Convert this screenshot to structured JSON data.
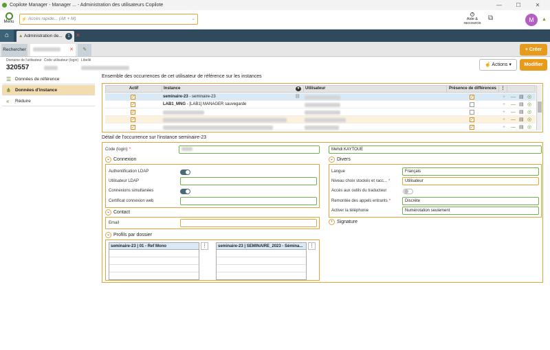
{
  "window": {
    "title": "Copilote Manager - Manager ... - Administration des utilisateurs Copilote"
  },
  "topbar": {
    "menu_label": "Menu",
    "quick_placeholder": "Accès rapide... (Alt + M)",
    "help_label": "Aide & raccourcis",
    "avatar_initial": "M"
  },
  "tabs": {
    "admin_label": "Administration de...",
    "admin_badge": "1"
  },
  "subtabs": {
    "search_label": "Rechercher"
  },
  "buttons": {
    "create": "+ Créer",
    "actions": "Actions",
    "modify": "Modifier"
  },
  "info": {
    "domain_label": "Domaine de l'utilisateur",
    "domain_value": "320557",
    "code_label": "Code utilisateur (login)",
    "libelle_label": "Libellé"
  },
  "sidebar": {
    "items": [
      {
        "label": "Données de référence",
        "icon": "list-icon"
      },
      {
        "label": "Données d'instance",
        "icon": "tree-icon"
      },
      {
        "label": "Réduire",
        "icon": "double-chevron-left-icon"
      }
    ]
  },
  "occurrences": {
    "title": "Ensemble des occurrences de cet utilisateur de référence sur les instances",
    "columns": [
      "Actif",
      "Instance",
      "Utilisateur",
      "Présence de différences"
    ],
    "rows": [
      {
        "active": true,
        "instance_code": "seminaire-23",
        "instance_name": " - seminaire-23",
        "diff": true,
        "selected": true
      },
      {
        "active": true,
        "instance_code": "LAB1_MNG",
        "instance_name": " - [LAB1] MANAGER sauvegarde",
        "diff": false
      },
      {
        "active": true,
        "instance_code": "",
        "instance_name": "",
        "diff": false
      },
      {
        "active": true,
        "instance_code": "",
        "instance_name": "",
        "diff": true,
        "alt": true
      },
      {
        "active": true,
        "instance_code": "",
        "instance_name": "",
        "diff": true
      }
    ]
  },
  "detail": {
    "title": "Détail de l'occurrence sur l'instance seminaire-23",
    "code_login_label": "Code (login)",
    "name_value": "Mehdi KAYTOUE",
    "connexion": {
      "title": "Connexion",
      "ldap_auth": "Authentification LDAP",
      "ldap_user": "Utilisateur LDAP",
      "simultaneous": "Connexions simultanées",
      "cert": "Certificat connexion web"
    },
    "contact": {
      "title": "Contact",
      "email": "Email"
    },
    "profils": {
      "title": "Profils par dossier",
      "list1": "seminaire-23 | 01 - Ref Mono",
      "list2": "seminaire-23 | SEMINAIRE_2023 - Sémina..."
    },
    "divers": {
      "title": "Divers",
      "langue_label": "Langue",
      "langue_value": "Français",
      "niveau_label": "Niveau choix stockés et racc...",
      "niveau_value": "Utilisateur",
      "traducteur_label": "Accès aux outils du traducteur",
      "remontee_label": "Remontée des appels entrants",
      "remontee_value": "Discrète",
      "telephonie_label": "Activer la téléphonie",
      "telephonie_value": "Numérotation seulement"
    },
    "signature": {
      "title": "Signature"
    }
  }
}
